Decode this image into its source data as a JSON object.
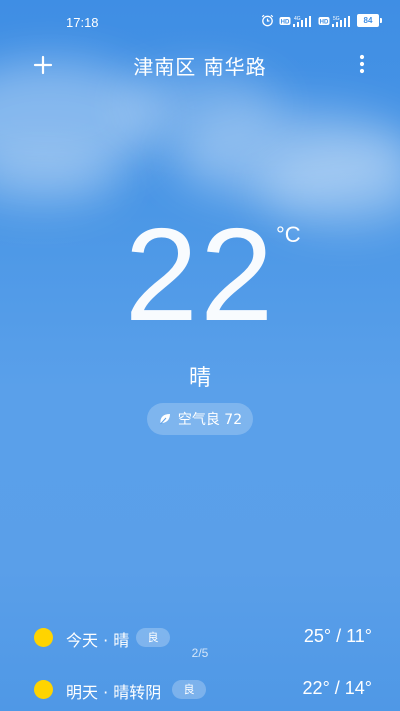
{
  "status_bar": {
    "time": "17:18",
    "battery": "84",
    "network_1": "4G",
    "network_2": "5G"
  },
  "header": {
    "city": "津南区 南华路"
  },
  "current": {
    "temperature": "22",
    "unit": "°C",
    "condition": "晴",
    "aqi_label": "空气良 72"
  },
  "pagination": "2/5",
  "forecast": [
    {
      "day": "今天 · 晴",
      "badge": "良",
      "temps": "25° / 11°",
      "icon": "sun-icon"
    },
    {
      "day": "明天 · 晴转阴",
      "badge": "良",
      "temps": "22° / 14°",
      "icon": "sun-icon"
    }
  ],
  "colors": {
    "sky": "#4b97e6",
    "sun": "#ffd400"
  }
}
